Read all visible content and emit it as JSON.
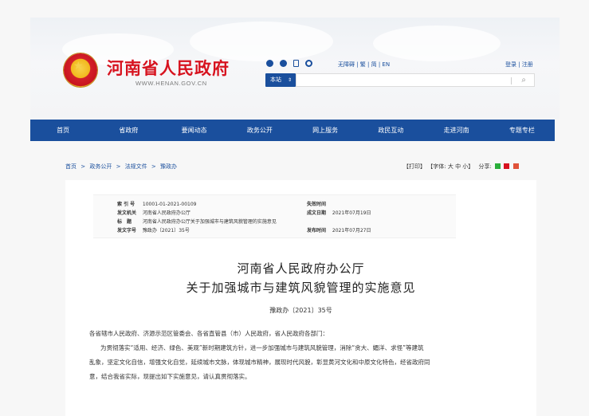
{
  "header": {
    "site_title": "河南省人民政府",
    "site_url": "WWW.HENAN.GOV.CN",
    "lang_links": "无障碍 | 繁 | 简 | EN",
    "login_links": "登录 | 注册",
    "site_select": "本站",
    "search_placeholder": ""
  },
  "nav": [
    "首页",
    "省政府",
    "要闻动态",
    "政务公开",
    "网上服务",
    "政民互动",
    "走进河南",
    "专题专栏"
  ],
  "breadcrumb": [
    "首页",
    ">",
    "政务公开",
    ">",
    "法规文件",
    ">",
    "豫政办"
  ],
  "tools": {
    "print": "【打印】",
    "font_label": "【字体:",
    "font_large": "大",
    "font_medium": "中",
    "font_small": "小】",
    "share_label": "分享:"
  },
  "meta": {
    "index_label": "索 引 号",
    "index_value": "10001-01-2021-00109",
    "agency_label": "发文机关",
    "agency_value": "河南省人民政府办公厅",
    "subject_label": "标　题",
    "subject_value": "河南省人民政府办公厅关于加强城市与建筑风貌管理的实施意见",
    "docno_label": "发文字号",
    "docno_value": "豫政办〔2021〕35号",
    "expire_label": "失效时间",
    "expire_value": "",
    "created_label": "成文日期",
    "created_value": "2021年07月19日",
    "publish_label": "发布时间",
    "publish_value": "2021年07月27日"
  },
  "document": {
    "title_line1": "河南省人民政府办公厅",
    "title_line2": "关于加强城市与建筑风貌管理的实施意见",
    "number": "豫政办〔2021〕35号",
    "recipients": "各省辖市人民政府、济源示范区管委会、各省直管县（市）人民政府，省人民政府各部门：",
    "para1_line1": "为贯彻落实“适用、经济、绿色、美观”新时期建筑方针，进一步加强城市与建筑风貌管理，消除“贪大、媚洋、求怪”等建筑",
    "para1_line2": "乱象，坚定文化自信，增强文化自觉，延续城市文脉，体现城市精神，展现时代风貌，彰显黄河文化和中原文化特色，经省政府同",
    "para1_line3": "意，结合我省实际，现提出如下实施意见，请认真贯彻落实。"
  },
  "colors": {
    "brand_red": "#d7131f",
    "nav_blue": "#1a4f9d"
  }
}
